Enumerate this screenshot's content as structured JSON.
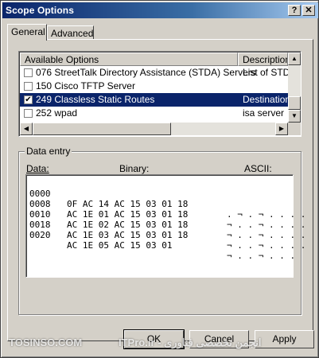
{
  "window": {
    "title": "Scope Options",
    "help_label": "?",
    "close_label": "✕"
  },
  "tabs": [
    {
      "label": "General",
      "active": true
    },
    {
      "label": "Advanced",
      "active": false
    }
  ],
  "options_list": {
    "columns": [
      "Available Options",
      "Description"
    ],
    "rows": [
      {
        "checked": false,
        "name": "076 StreetTalk Directory Assistance (STDA) Servers",
        "description": "List of STDA",
        "selected": false
      },
      {
        "checked": false,
        "name": "150 Cisco TFTP Server",
        "description": "",
        "selected": false
      },
      {
        "checked": true,
        "name": "249 Classless Static Routes",
        "description": "Destination,",
        "selected": true
      },
      {
        "checked": false,
        "name": "252 wpad",
        "description": "isa server",
        "selected": false
      }
    ]
  },
  "data_entry": {
    "group_label": "Data entry",
    "data_label": "Data:",
    "binary_label": "Binary:",
    "ascii_label": "ASCII:",
    "rows": [
      {
        "offset": "0000",
        "hex": "0F AC 14 AC 15 03 01 18",
        "ascii": ". ¬ . ¬ . . . ."
      },
      {
        "offset": "0008",
        "hex": "AC 1E 01 AC 15 03 01 18",
        "ascii": "¬ . . ¬ . . . ."
      },
      {
        "offset": "0010",
        "hex": "AC 1E 02 AC 15 03 01 18",
        "ascii": "¬ . . ¬ . . . ."
      },
      {
        "offset": "0018",
        "hex": "AC 1E 03 AC 15 03 01 18",
        "ascii": "¬ . . ¬ . . . ."
      },
      {
        "offset": "0020",
        "hex": "AC 1E 05 AC 15 03 01",
        "ascii": "¬ . . ¬ . . ."
      }
    ]
  },
  "buttons": {
    "ok": "OK",
    "cancel": "Cancel",
    "apply": "Apply"
  },
  "watermark": {
    "left": "TOSINSO.COM",
    "right": "ITPro.ir - انجمن تخصصی فناوری"
  }
}
